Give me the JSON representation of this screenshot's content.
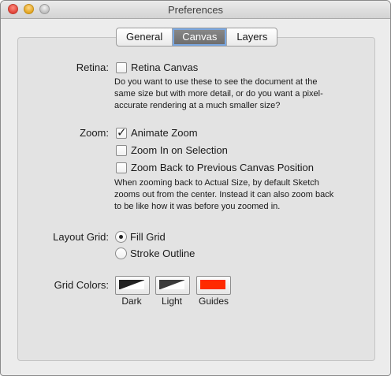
{
  "window": {
    "title": "Preferences"
  },
  "tabs": [
    {
      "label": "General",
      "selected": false
    },
    {
      "label": "Canvas",
      "selected": true
    },
    {
      "label": "Layers",
      "selected": false
    }
  ],
  "retina": {
    "label": "Retina:",
    "checkbox_label": "Retina Canvas",
    "checked": false,
    "description_lines": [
      "Do you want to use these to see the document at the",
      "same size but with more detail, or do you want a pixel-",
      "accurate rendering at a much smaller size?"
    ]
  },
  "zoom": {
    "label": "Zoom:",
    "options": [
      {
        "label": "Animate Zoom",
        "checked": true
      },
      {
        "label": "Zoom In on Selection",
        "checked": false
      },
      {
        "label": "Zoom Back to Previous Canvas Position",
        "checked": false
      }
    ],
    "description_lines": [
      "When zooming back to Actual Size, by default Sketch",
      "zooms out from the center. Instead it can also zoom back",
      "to be like how it was before you zoomed in."
    ]
  },
  "layout_grid": {
    "label": "Layout Grid:",
    "options": [
      {
        "label": "Fill Grid",
        "selected": true
      },
      {
        "label": "Stroke Outline",
        "selected": false
      }
    ]
  },
  "grid_colors": {
    "label": "Grid Colors:",
    "wells": [
      {
        "label": "Dark",
        "color": "#222222"
      },
      {
        "label": "Light",
        "color": "#3a3a3a"
      },
      {
        "label": "Guides",
        "color": "#ff2a00"
      }
    ]
  }
}
